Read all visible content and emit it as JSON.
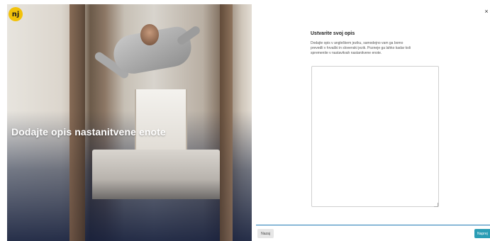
{
  "brand": {
    "logo_text": "nj",
    "logo_color": "#f2c20a"
  },
  "hero": {
    "title": "Dodajte opis nastanitvene enote"
  },
  "dialog": {
    "close_icon": "×",
    "title": "Ustvarite svoj opis",
    "help_lines": [
      "Dodajte opis v angleškem jeziku, samodejno vam ga bomo",
      "prevedli v hrvaški in slovenski jezik. Pozneje ga lahko kadar koli",
      "spremenite v nastavitvah nastanitvene enote."
    ],
    "textarea": {
      "value": "",
      "placeholder": ""
    }
  },
  "footer": {
    "back_label": "Nazaj",
    "next_label": "Naprej",
    "accent_color": "#2a9db5"
  }
}
